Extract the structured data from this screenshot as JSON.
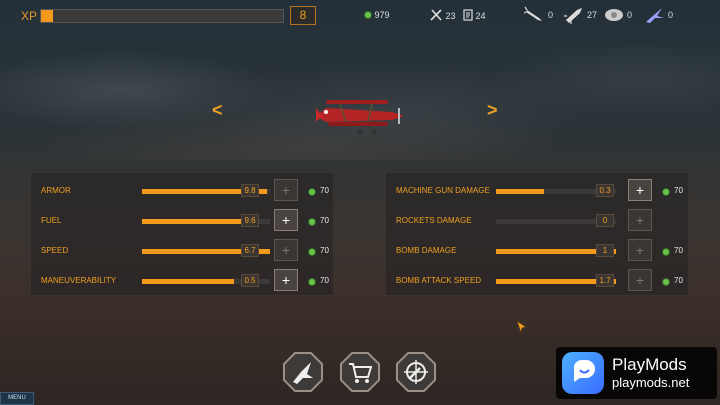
{
  "topbar": {
    "xp_label": "XP",
    "xp_progress": 0.05,
    "level": "8",
    "coins": "979",
    "tools": "23",
    "blueprints": "24",
    "ammo": [
      {
        "icon": "bomb-icon",
        "count": "0"
      },
      {
        "icon": "rocket-icon",
        "count": "27"
      },
      {
        "icon": "cluster-bomb-icon",
        "count": "0"
      },
      {
        "icon": "fighter-jet-icon",
        "count": "0"
      }
    ]
  },
  "nav": {
    "prev": "<",
    "next": ">"
  },
  "stats_left": [
    {
      "label": "ARMOR",
      "value": "9.8",
      "fill": 0.98,
      "price": "70",
      "upgradable": false,
      "show_price": true
    },
    {
      "label": "FUEL",
      "value": "9.6",
      "fill": 0.87,
      "price": "70",
      "upgradable": true,
      "show_price": true
    },
    {
      "label": "SPEED",
      "value": "6.7",
      "fill": 1.0,
      "price": "70",
      "upgradable": false,
      "show_price": true
    },
    {
      "label": "MANEUVERABILITY",
      "value": "0.5",
      "fill": 0.72,
      "price": "70",
      "upgradable": true,
      "show_price": true
    }
  ],
  "stats_right": [
    {
      "label": "MACHINE GUN DAMAGE",
      "value": "0.3",
      "fill": 0.4,
      "price": "70",
      "upgradable": true,
      "show_price": true
    },
    {
      "label": "ROCKETS DAMAGE",
      "value": "0",
      "fill": 0.0,
      "price": "",
      "upgradable": false,
      "show_price": false
    },
    {
      "label": "BOMB DAMAGE",
      "value": "1",
      "fill": 1.0,
      "price": "70",
      "upgradable": false,
      "show_price": true
    },
    {
      "label": "BOMB ATTACK SPEED",
      "value": "1.7",
      "fill": 1.0,
      "price": "70",
      "upgradable": false,
      "show_price": true
    }
  ],
  "plus_symbol": "+",
  "bottom_buttons": [
    "hangar-plane-button",
    "shop-cart-button",
    "target-button"
  ],
  "menu_label": "MENU",
  "watermark": {
    "line1": "PlayMods",
    "line2": "playmods.net"
  },
  "colors": {
    "accent": "#f39a1d",
    "coin": "#6ac24a"
  }
}
